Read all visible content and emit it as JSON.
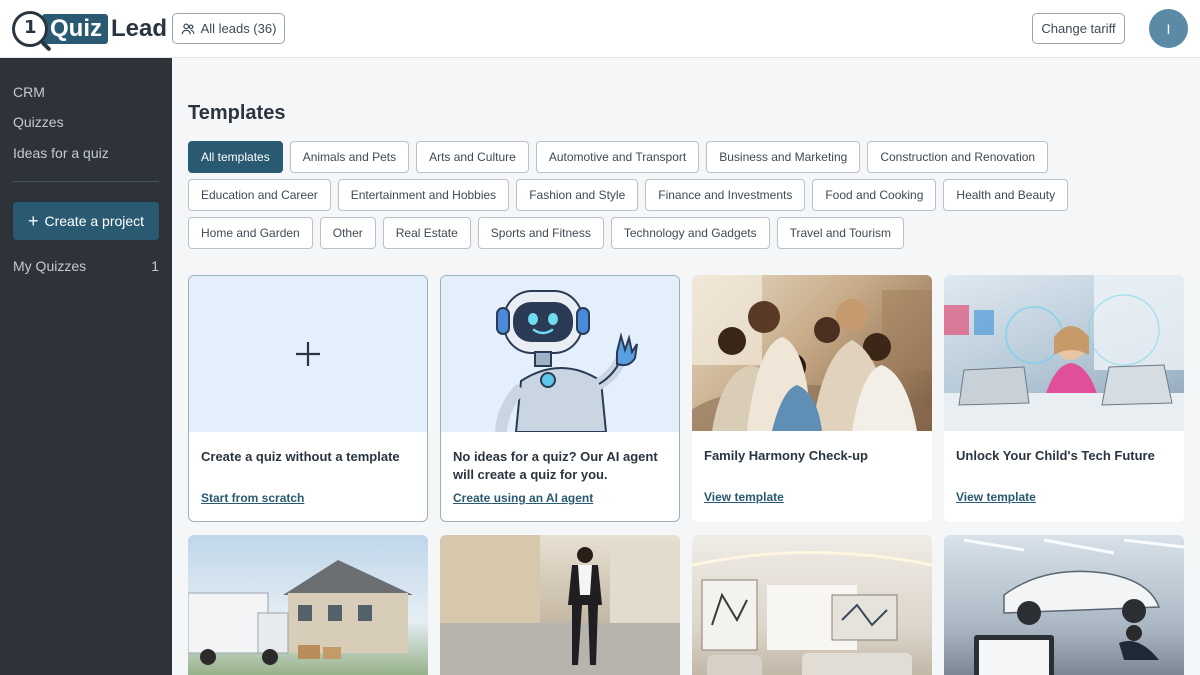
{
  "header": {
    "logo_quiz": "Quiz",
    "logo_lead": "Lead",
    "logo_digit": "1",
    "leads_button": "All leads (36)",
    "tariff_button": "Change tariff",
    "avatar_initial": "I"
  },
  "sidebar": {
    "items": [
      {
        "label": "CRM"
      },
      {
        "label": "Quizzes"
      },
      {
        "label": "Ideas for a quiz"
      }
    ],
    "create_button": "Create a project",
    "my_quizzes": {
      "label": "My Quizzes",
      "count": "1"
    }
  },
  "main": {
    "title": "Templates",
    "categories": [
      "All templates",
      "Animals and Pets",
      "Arts and Culture",
      "Automotive and Transport",
      "Business and Marketing",
      "Construction and Renovation",
      "Education and Career",
      "Entertainment and Hobbies",
      "Fashion and Style",
      "Finance and Investments",
      "Food and Cooking",
      "Health and Beauty",
      "Home and Garden",
      "Other",
      "Real Estate",
      "Sports and Fitness",
      "Technology and Gadgets",
      "Travel and Tourism"
    ],
    "active_category": "All templates",
    "cards": [
      {
        "title": "Create a quiz without a template",
        "link": "Start from scratch"
      },
      {
        "title": "No ideas for a quiz? Our AI agent will create a quiz for you.",
        "link": "Create using an AI agent"
      },
      {
        "title": "Family Harmony Check-up",
        "link": "View template"
      },
      {
        "title": "Unlock Your Child's Tech Future",
        "link": "View template"
      }
    ]
  },
  "colors": {
    "brand": "#2a5a72",
    "sidebar_bg": "#2d3339",
    "page_bg": "#f5f6f7"
  }
}
